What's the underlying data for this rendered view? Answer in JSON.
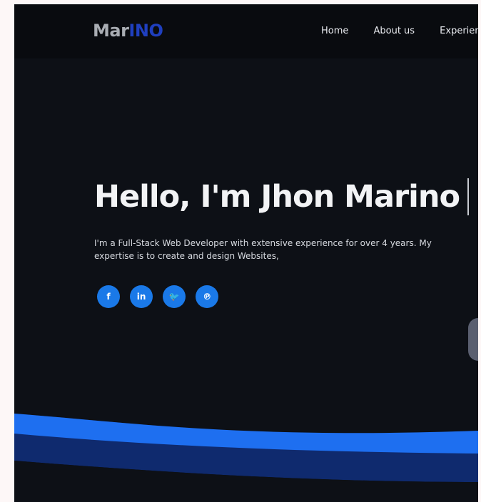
{
  "logo": {
    "part1": "Mar",
    "part2": "INO"
  },
  "nav": {
    "items": [
      "Home",
      "About us",
      "Experience"
    ]
  },
  "hero": {
    "title": "Hello, I'm Jhon Marino",
    "description": "I'm a Full-Stack Web Developer with extensive experience for over 4 years. My expertise is to create and design Websites,"
  },
  "socials": [
    {
      "icon": "facebook-icon",
      "glyph": "f"
    },
    {
      "icon": "linkedin-icon",
      "glyph": "in"
    },
    {
      "icon": "twitter-icon",
      "glyph": "🐦"
    },
    {
      "icon": "pinterest-icon",
      "glyph": "℗"
    }
  ],
  "colors": {
    "background": "#0d1016",
    "navbar": "#090b0f",
    "accent": "#1a79e8",
    "logo_accent": "#1f3fbf",
    "wave_bright": "#1e6ff0",
    "wave_dark": "#0f2a6e"
  }
}
